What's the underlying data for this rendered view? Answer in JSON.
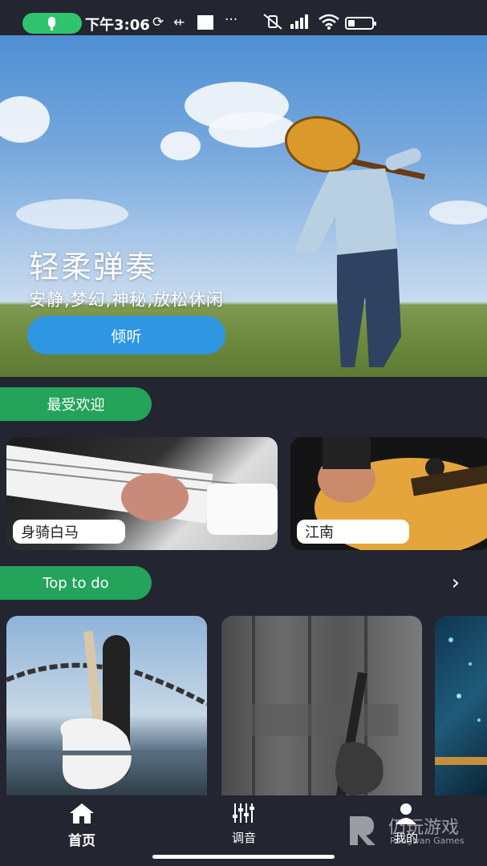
{
  "status_bar": {
    "time": "下午3:06",
    "dots": "···"
  },
  "hero": {
    "title": "轻柔弹奏",
    "subtitle": "安静,梦幻,神秘,放松休闲",
    "button_label": "倾听"
  },
  "sections": {
    "popular": {
      "label": "最受欢迎",
      "cards": [
        {
          "label": "身骑白马"
        },
        {
          "label": "江南"
        }
      ]
    },
    "top": {
      "label": "Top to do",
      "more_icon": "chevron-right-icon"
    }
  },
  "nav": {
    "items": [
      {
        "label": "首页",
        "icon": "home-icon",
        "active": true
      },
      {
        "label": "调音",
        "icon": "equalizer-icon",
        "active": false
      },
      {
        "label": "我的",
        "icon": "user-icon",
        "active": false
      }
    ]
  },
  "watermark": {
    "title": "仍玩游戏",
    "subtitle": "Rengwan Games"
  },
  "colors": {
    "background": "#232531",
    "accent_green": "#24a35a",
    "button_blue": "#2f96e3"
  }
}
